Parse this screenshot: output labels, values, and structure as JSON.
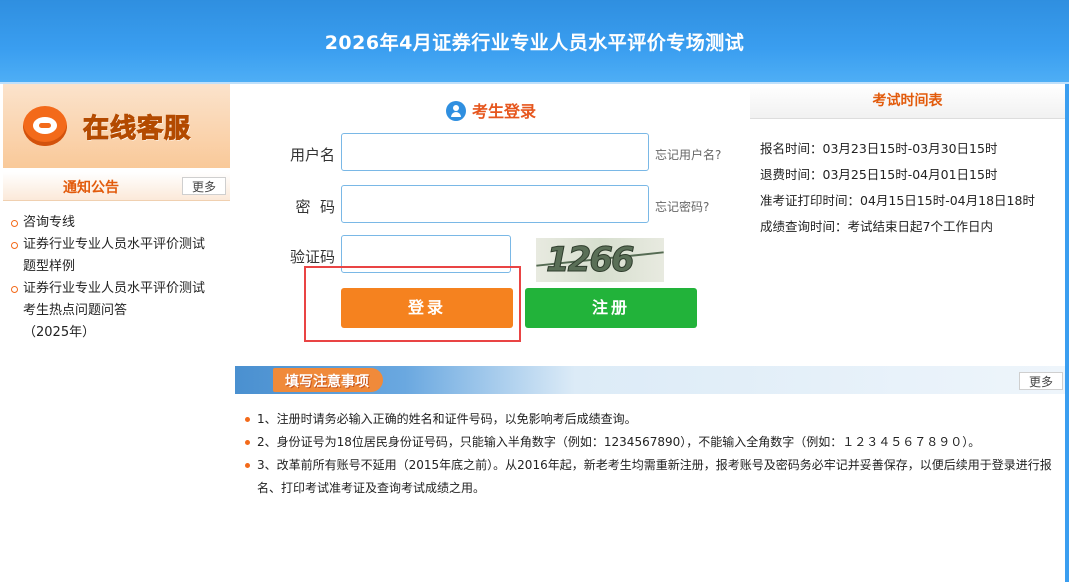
{
  "header": {
    "title": "2026年4月证券行业专业人员水平评价专场测试"
  },
  "sidebar": {
    "service_text": "在线客服",
    "notice_title": "通知公告",
    "more_label": "更多",
    "items": [
      {
        "label": "咨询专线"
      },
      {
        "label": "证券行业专业人员水平评价测试"
      },
      {
        "label": "题型样例"
      },
      {
        "label": "证券行业专业人员水平评价测试"
      },
      {
        "label": "考生热点问题问答"
      },
      {
        "label": "（2025年）"
      }
    ]
  },
  "login": {
    "title": "考生登录",
    "username_label": "用户名",
    "username_value": "",
    "forgot_username": "忘记用户名?",
    "password_label": "密  码",
    "password_value": "",
    "forgot_password": "忘记密码?",
    "captcha_label": "验证码",
    "captcha_value": "",
    "captcha_text": "1266",
    "login_button": "登录",
    "register_button": "注册"
  },
  "schedule": {
    "title": "考试时间表",
    "items": [
      "报名时间：03月23日15时-03月30日15时",
      "退费时间：03月25日15时-04月01日15时",
      "准考证打印时间：04月15日15时-04月18日18时",
      "成绩查询时间：考试结束日起7个工作日内"
    ]
  },
  "notes": {
    "title": "填写注意事项",
    "more_label": "更多",
    "items": [
      "1、注册时请务必输入正确的姓名和证件号码，以免影响考后成绩查询。",
      "2、身份证号为18位居民身份证号码，只能输入半角数字（例如：1234567890），不能输入全角数字（例如：１２３４５６７８９０）。",
      "3、改革前所有账号不延用（2015年底之前）。从2016年起，新老考生均需重新注册，报考账号及密码务必牢记并妥善保存，以便后续用于登录进行报名、打印考试准考证及查询考试成绩之用。"
    ]
  },
  "colors": {
    "header_blue": "#3a9ef0",
    "accent_orange": "#f5821f",
    "register_green": "#22b33a",
    "highlight_red": "#e94444"
  }
}
